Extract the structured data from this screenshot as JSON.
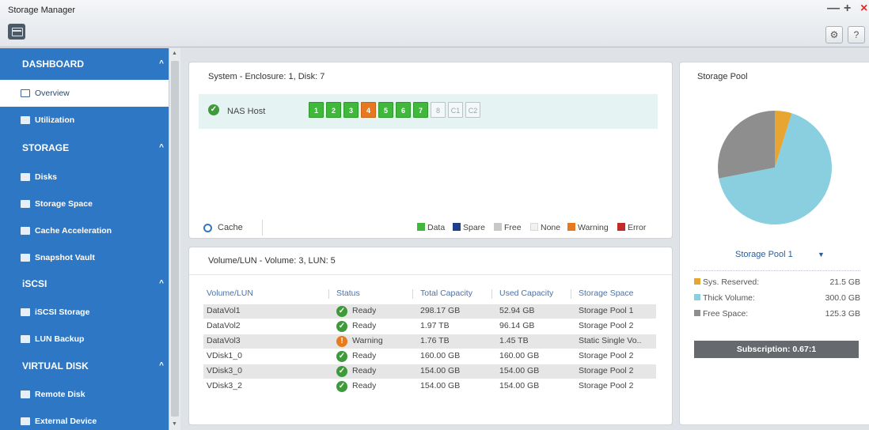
{
  "window": {
    "title": "Storage Manager",
    "minimize_glyph": "—",
    "maximize_glyph": "+",
    "close_glyph": "×",
    "settings_glyph": "⚙",
    "help_glyph": "?"
  },
  "sidebar": {
    "sections": [
      {
        "label": "DASHBOARD",
        "items": [
          {
            "label": "Overview",
            "icon": "overview-icon",
            "active": true
          },
          {
            "label": "Utilization",
            "icon": "utilization-icon"
          }
        ]
      },
      {
        "label": "STORAGE",
        "items": [
          {
            "label": "Disks",
            "icon": "disks-icon"
          },
          {
            "label": "Storage Space",
            "icon": "storage-space-icon"
          },
          {
            "label": "Cache Acceleration",
            "icon": "cache-icon"
          },
          {
            "label": "Snapshot Vault",
            "icon": "snapshot-icon"
          }
        ]
      },
      {
        "label": "iSCSI",
        "items": [
          {
            "label": "iSCSI Storage",
            "icon": "iscsi-storage-icon"
          },
          {
            "label": "LUN Backup",
            "icon": "lun-backup-icon"
          }
        ]
      },
      {
        "label": "VIRTUAL DISK",
        "items": [
          {
            "label": "Remote Disk",
            "icon": "remote-disk-icon"
          },
          {
            "label": "External Device",
            "icon": "external-device-icon"
          }
        ]
      }
    ]
  },
  "system": {
    "title": "System - Enclosure: 1, Disk: 7",
    "host_label": "NAS Host",
    "disks": [
      {
        "label": "1",
        "state": "data"
      },
      {
        "label": "2",
        "state": "data"
      },
      {
        "label": "3",
        "state": "data"
      },
      {
        "label": "4",
        "state": "warning"
      },
      {
        "label": "5",
        "state": "data"
      },
      {
        "label": "6",
        "state": "data"
      },
      {
        "label": "7",
        "state": "data"
      },
      {
        "label": "8",
        "state": "empty"
      },
      {
        "label": "C1",
        "state": "empty"
      },
      {
        "label": "C2",
        "state": "empty"
      }
    ],
    "cache_label": "Cache",
    "legend": [
      {
        "label": "Data",
        "color": "#3fb83b"
      },
      {
        "label": "Spare",
        "color": "#1f3f8a"
      },
      {
        "label": "Free",
        "color": "#c8c8c8"
      },
      {
        "label": "None",
        "color": "#f1f1f1"
      },
      {
        "label": "Warning",
        "color": "#e6781f"
      },
      {
        "label": "Error",
        "color": "#c42a2a"
      }
    ]
  },
  "volumes": {
    "title": "Volume/LUN - Volume: 3, LUN: 5",
    "columns": [
      "Volume/LUN",
      "Status",
      "Total Capacity",
      "Used Capacity",
      "Storage Space"
    ],
    "rows": [
      [
        "DataVol1",
        "Ready",
        "298.17 GB",
        "52.94 GB",
        "Storage Pool 1"
      ],
      [
        "DataVol2",
        "Ready",
        "1.97 TB",
        "96.14 GB",
        "Storage Pool 2"
      ],
      [
        "DataVol3",
        "Warning",
        "1.76 TB",
        "1.45 TB",
        "Static Single Vo.."
      ],
      [
        "VDisk1_0",
        "Ready",
        "160.00 GB",
        "160.00 GB",
        "Storage Pool 2"
      ],
      [
        "VDisk3_0",
        "Ready",
        "154.00 GB",
        "154.00 GB",
        "Storage Pool 2"
      ],
      [
        "VDisk3_2",
        "Ready",
        "154.00 GB",
        "154.00 GB",
        "Storage Pool 2"
      ]
    ]
  },
  "pool": {
    "title": "Storage Pool",
    "selected": "Storage Pool 1",
    "chart_data": {
      "type": "pie",
      "slices": [
        {
          "label": "Sys. Reserved:",
          "value": 21.5,
          "display": "21.5 GB",
          "color": "#e9a531"
        },
        {
          "label": "Thick Volume:",
          "value": 300.0,
          "display": "300.0 GB",
          "color": "#89cfe0"
        },
        {
          "label": "Free Space:",
          "value": 125.3,
          "display": "125.3 GB",
          "color": "#8e8e8e"
        }
      ]
    },
    "subscription": "Subscription: 0.67:1"
  },
  "colors": {
    "sidebar_bg": "#2e77c4",
    "accent": "#2d5c95"
  }
}
